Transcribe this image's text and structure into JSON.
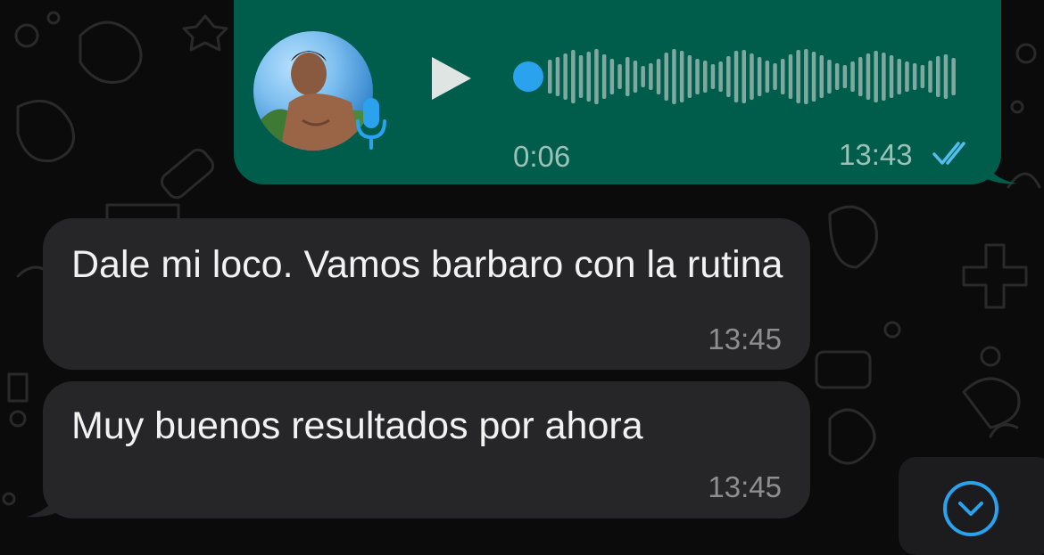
{
  "colors": {
    "outgoing_bubble": "#005c4b",
    "incoming_bubble": "#262628",
    "accent_blue": "#2aa2ee",
    "background": "#0b0b0b"
  },
  "voice_message": {
    "duration": "0:06",
    "time": "13:43",
    "status_icon": "double-check-read-icon",
    "play_icon": "play-icon",
    "mic_icon": "microphone-icon",
    "playback_progress": 0
  },
  "messages": [
    {
      "text": "Dale mi loco. Vamos barbaro con la rutina",
      "time": "13:45"
    },
    {
      "text": "Muy buenos resultados por ahora",
      "time": "13:45"
    }
  ],
  "scroll_button": {
    "icon": "chevron-down-icon"
  }
}
